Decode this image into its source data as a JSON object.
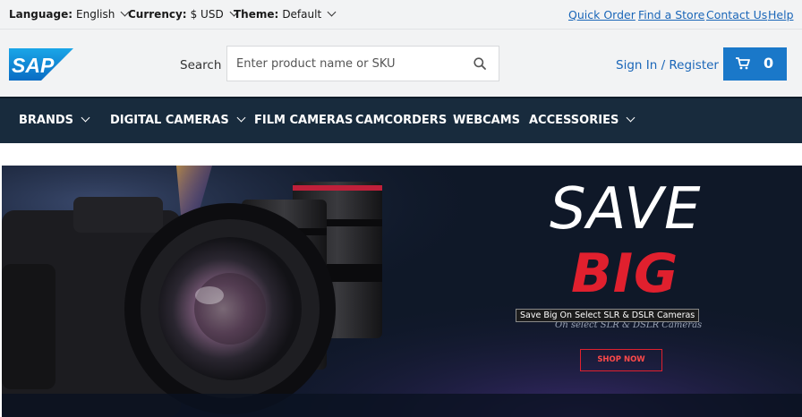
{
  "topbar": {
    "language": {
      "label": "Language:",
      "value": "English"
    },
    "currency": {
      "label": "Currency:",
      "value": "$ USD"
    },
    "theme": {
      "label": "Theme:",
      "value": "Default"
    },
    "links": [
      "Quick Order",
      "Find a Store",
      "Contact Us",
      "Help"
    ]
  },
  "header": {
    "logo_text": "SAP",
    "search_label": "Search",
    "search_placeholder": "Enter product name or SKU",
    "signin": "Sign In / Register",
    "cart_count": "0"
  },
  "nav": {
    "items": [
      "BRANDS",
      "DIGITAL CAMERAS",
      "FILM CAMERAS",
      "CAMCORDERS",
      "WEBCAMS",
      "ACCESSORIES"
    ]
  },
  "hero": {
    "headline_1": "SAVE",
    "headline_2": "BIG",
    "subline": "On select SLR & DSLR Cameras",
    "tooltip": "Save Big On Select SLR & DSLR Cameras",
    "cta": "SHOP NOW"
  },
  "colors": {
    "link": "#1a66b8",
    "nav_bg": "#182b3d",
    "cart_bg": "#1a78c9",
    "accent_red": "#e0202e"
  }
}
